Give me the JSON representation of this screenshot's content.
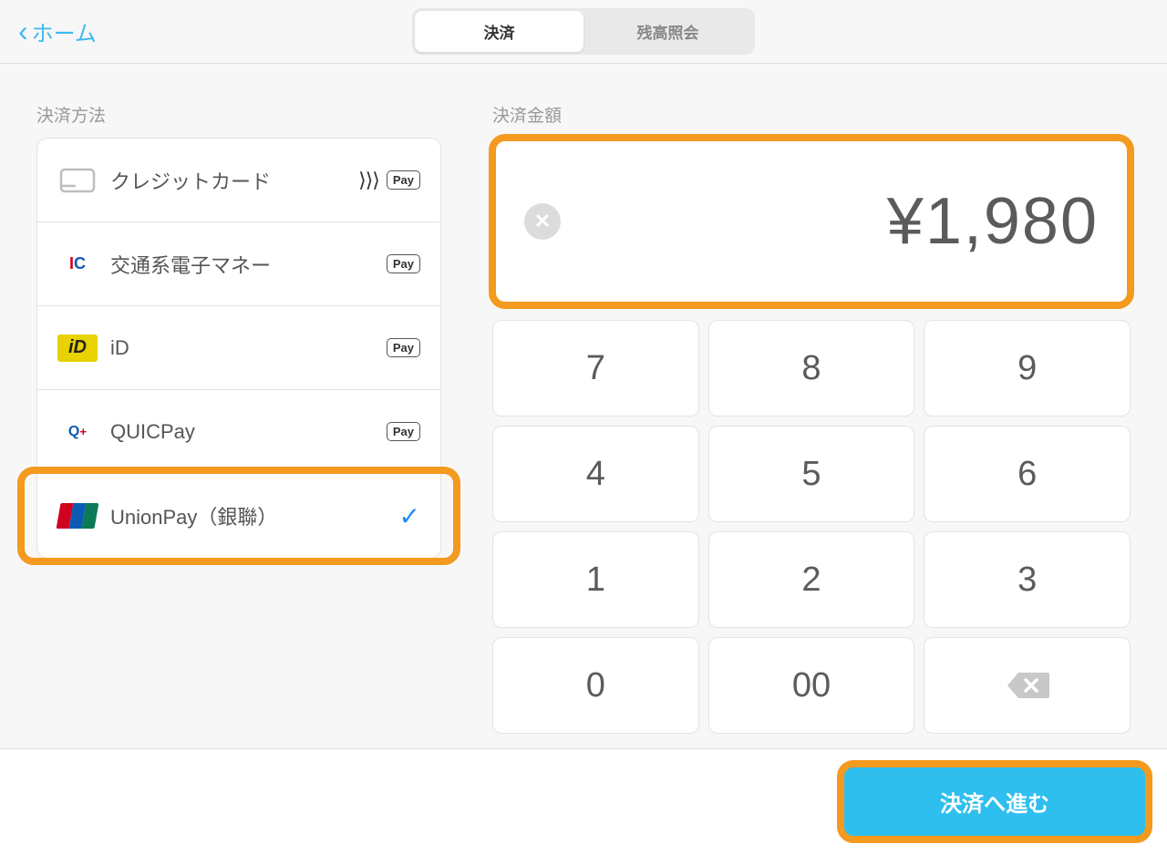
{
  "header": {
    "back_label": "ホーム",
    "tabs": {
      "payment": "決済",
      "balance": "残高照会"
    }
  },
  "left": {
    "section_label": "決済方法",
    "items": [
      {
        "label": "クレジットカード",
        "apple_pay": true,
        "contactless": true
      },
      {
        "label": "交通系電子マネー",
        "apple_pay": true
      },
      {
        "label": "iD",
        "apple_pay": true
      },
      {
        "label": "QUICPay",
        "apple_pay": true
      },
      {
        "label": "UnionPay（銀聯）",
        "selected": true
      }
    ]
  },
  "right": {
    "section_label": "決済金額",
    "amount_display": "¥1,980",
    "keypad": {
      "keys": [
        "7",
        "8",
        "9",
        "4",
        "5",
        "6",
        "1",
        "2",
        "3",
        "0",
        "00"
      ]
    }
  },
  "footer": {
    "proceed_label": "決済へ進む"
  },
  "apple_pay_label": "Pay"
}
